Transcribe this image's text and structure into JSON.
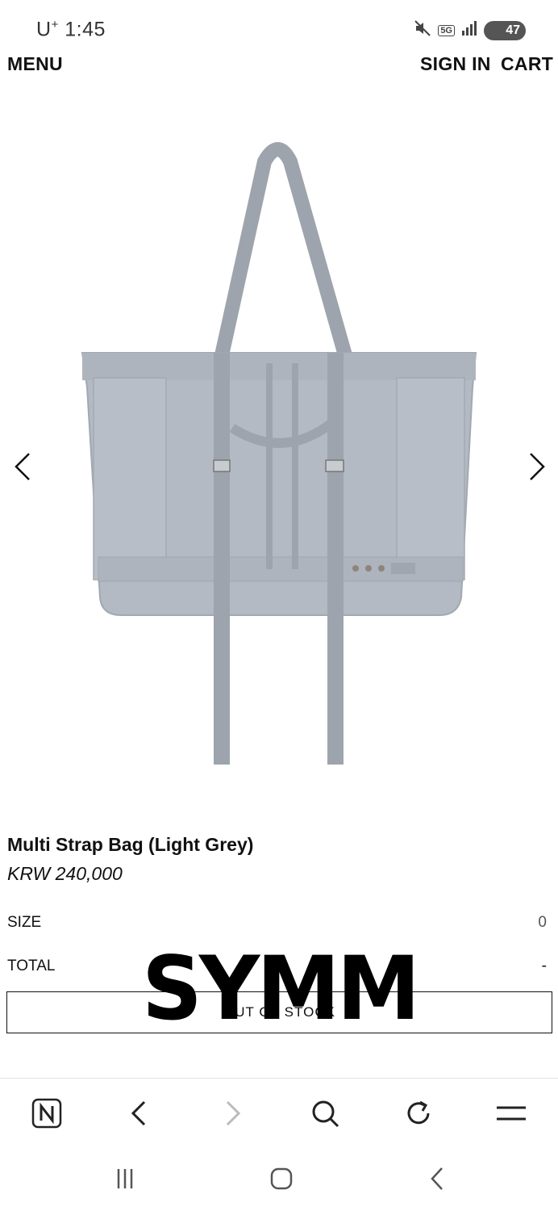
{
  "status_bar": {
    "carrier": "U",
    "carrier_sup": "+",
    "time": "1:45",
    "network": "5G",
    "battery": "47"
  },
  "nav": {
    "menu": "MENU",
    "sign_in": "SIGN IN",
    "cart": "CART"
  },
  "product": {
    "name": "Multi Strap Bag (Light Grey)",
    "price": "KRW 240,000",
    "color_hex": "#aab0b9"
  },
  "options": {
    "size_label": "SIZE",
    "size_value": "0",
    "total_label": "TOTAL",
    "total_value": "-"
  },
  "button": {
    "label": "OUT OF STOCK"
  },
  "watermark": {
    "text": "SYMM"
  },
  "browser_toolbar": {
    "icons": [
      "naver-home-icon",
      "back-icon",
      "forward-icon",
      "search-icon",
      "refresh-icon",
      "menu-icon"
    ]
  },
  "system_nav": {
    "icons": [
      "recent-apps-icon",
      "home-icon",
      "back-icon"
    ]
  }
}
